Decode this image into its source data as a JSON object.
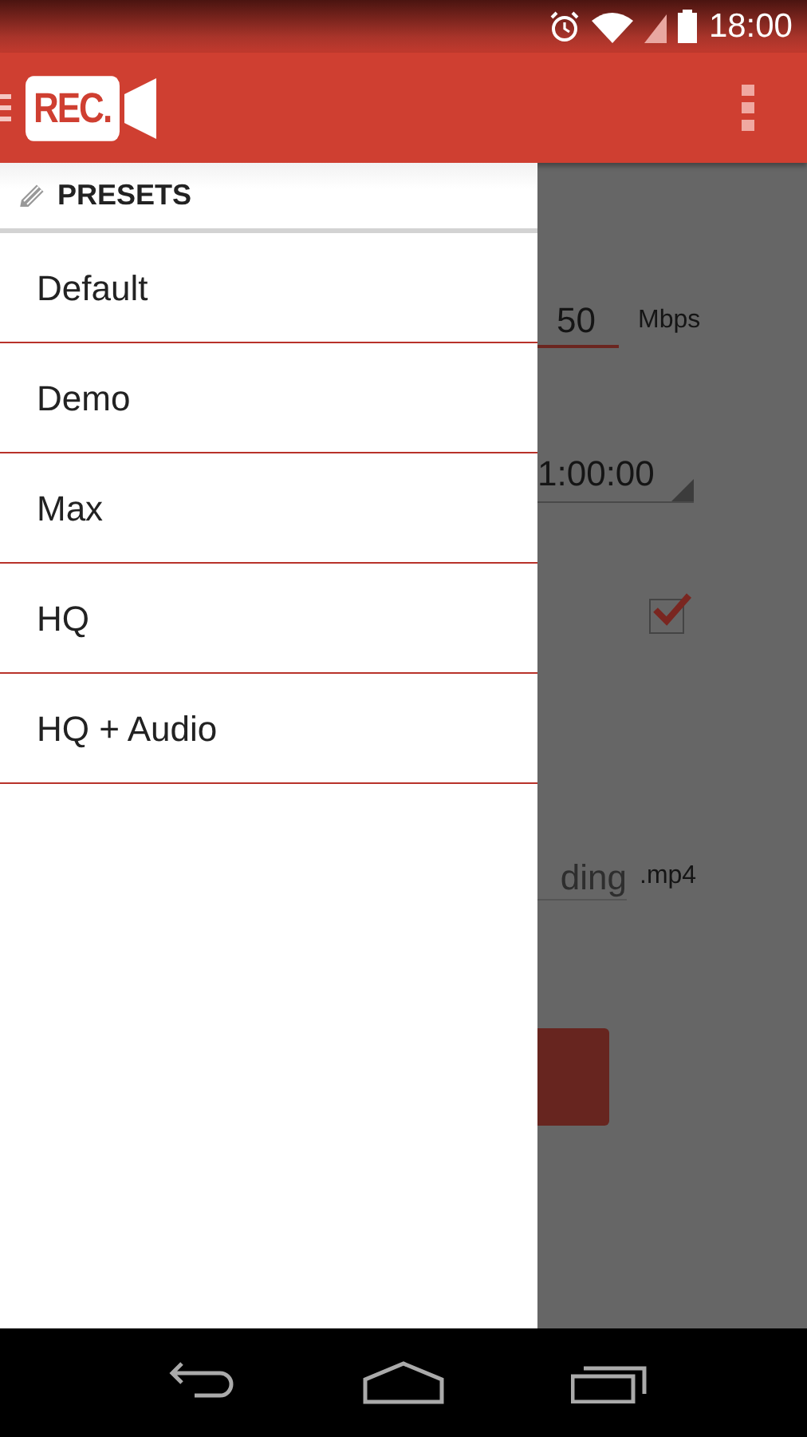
{
  "status_bar": {
    "time": "18:00"
  },
  "app_bar": {
    "logo": "REC."
  },
  "drawer": {
    "header": "PRESETS",
    "items": [
      {
        "label": "Default",
        "selected": false
      },
      {
        "label": "Demo",
        "selected": false
      },
      {
        "label": "Max",
        "selected": false
      },
      {
        "label": "HQ",
        "selected": false
      },
      {
        "label": "HQ + Audio",
        "selected": false
      }
    ]
  },
  "background_form": {
    "bitrate": {
      "value": "50",
      "unit": "Mbps"
    },
    "duration": {
      "value": "1:00:00"
    },
    "record_audio": {
      "checked": true
    },
    "filename": {
      "placeholder": "ding",
      "extension": ".mp4"
    }
  }
}
